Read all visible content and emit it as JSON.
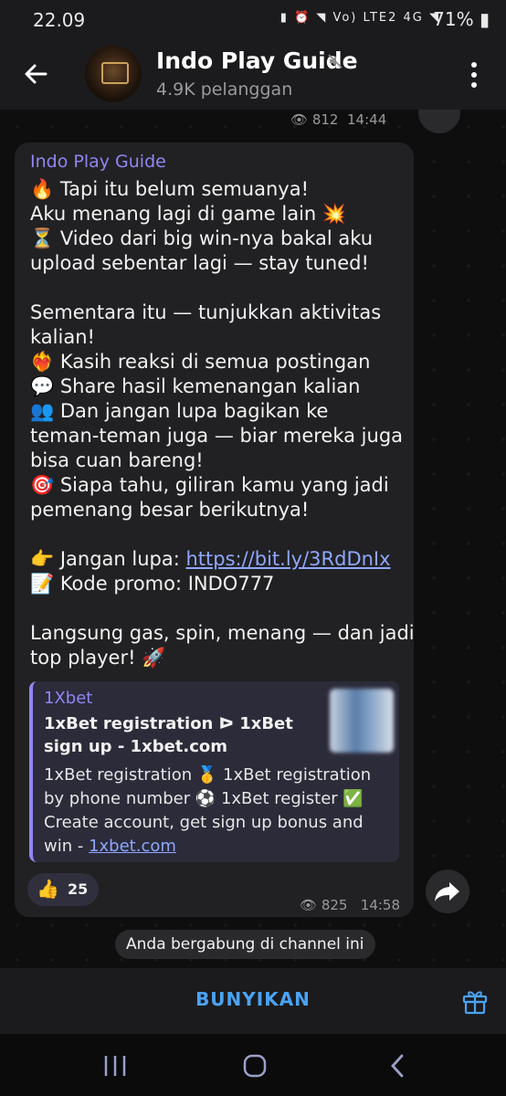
{
  "status_bar": {
    "time": "22.09",
    "network_labels": "Vo) LTE2  4G",
    "battery_percent": "71%"
  },
  "header": {
    "title": "Indo Play Guide",
    "subtitle": "4.9K pelanggan"
  },
  "previous_message": {
    "views": "812",
    "time": "14:44"
  },
  "message": {
    "sender": "Indo Play Guide",
    "lines": [
      "🔥 Tapi itu belum semuanya!",
      "Aku menang lagi di game lain 💥",
      "⏳ Video dari big win-nya bakal aku",
      "upload sebentar lagi — stay tuned!",
      "",
      "Sementara itu — tunjukkan aktivitas",
      "kalian!",
      "❤️‍🔥 Kasih reaksi di semua postingan",
      "💬 Share hasil kemenangan kalian",
      "👥 Dan jangan lupa bagikan ke",
      "teman-teman juga — biar mereka juga",
      "bisa cuan bareng!",
      "🎯 Siapa tahu, giliran kamu yang jadi",
      "pemenang besar berikutnya!",
      ""
    ],
    "link_prefix": "👉 Jangan lupa: ",
    "link_text": "https://bit.ly/3RdDnIx",
    "promo_line": "📝 Kode promo: INDO777",
    "closing_lines": [
      "Langsung gas, spin, menang — dan jadi",
      "top player! 🚀"
    ],
    "preview": {
      "site": "1Xbet",
      "title": "1xBet registration ᐅ 1xBet sign up - 1xbet.com",
      "description": "1xBet registration 🥇 1xBet registration by phone number ⚽ 1xBet register ✅ Create account, get sign up bonus and win - ",
      "description_link": "1xbet.com"
    },
    "reaction": {
      "emoji": "👍",
      "count": "25"
    },
    "views": "825",
    "time": "14:58"
  },
  "service_message": "Anda bergabung di channel ini",
  "bottom_bar": {
    "unmute_label": "BUNYIKAN"
  },
  "colors": {
    "accent": "#8f86f2",
    "link": "#8fa7ff",
    "button_text": "#4aa3f2",
    "bubble": "#212123",
    "background": "#0e0e0f"
  }
}
